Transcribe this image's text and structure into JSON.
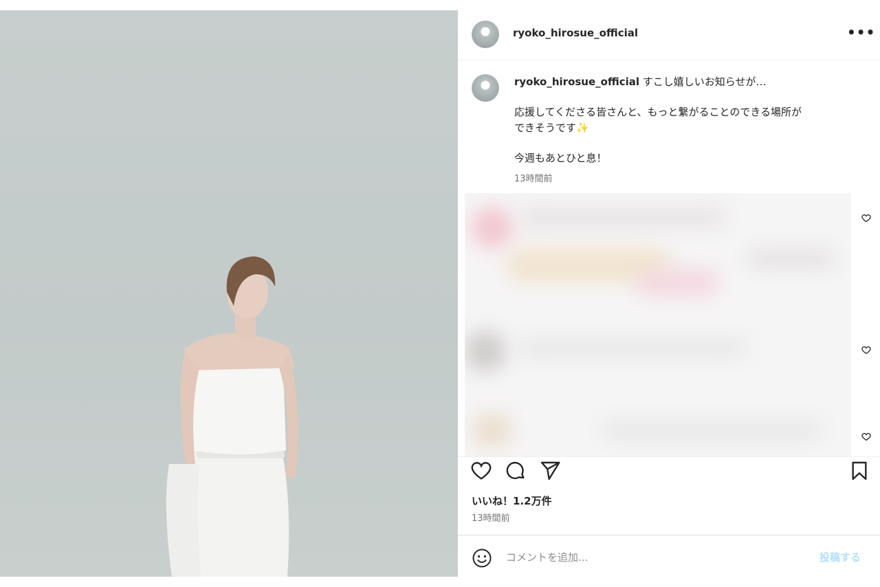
{
  "post": {
    "username": "ryoko_hirosue_official",
    "caption_user": "ryoko_hirosue_official",
    "caption_line1": " すこし嬉しいお知らせが…",
    "caption_line2": "応援してくださる皆さんと、もっと繋がることのできる場所が",
    "caption_line3": "できそうです✨",
    "caption_line4": "今週もあとひと息！",
    "caption_time": "13時間前",
    "likes": "いいね！1.2万件",
    "time": "13時間前"
  },
  "comment_box": {
    "placeholder": "コメントを追加...",
    "submit_label": "投稿する"
  },
  "icons": {
    "more": "more-options-icon",
    "like": "heart-icon",
    "comment": "comment-icon",
    "share": "share-icon",
    "save": "bookmark-icon",
    "emoji": "emoji-icon"
  },
  "colors": {
    "text": "#262626",
    "muted": "#737373",
    "post_button_disabled": "#b2dffc",
    "photo_background": "#c5cccb"
  }
}
